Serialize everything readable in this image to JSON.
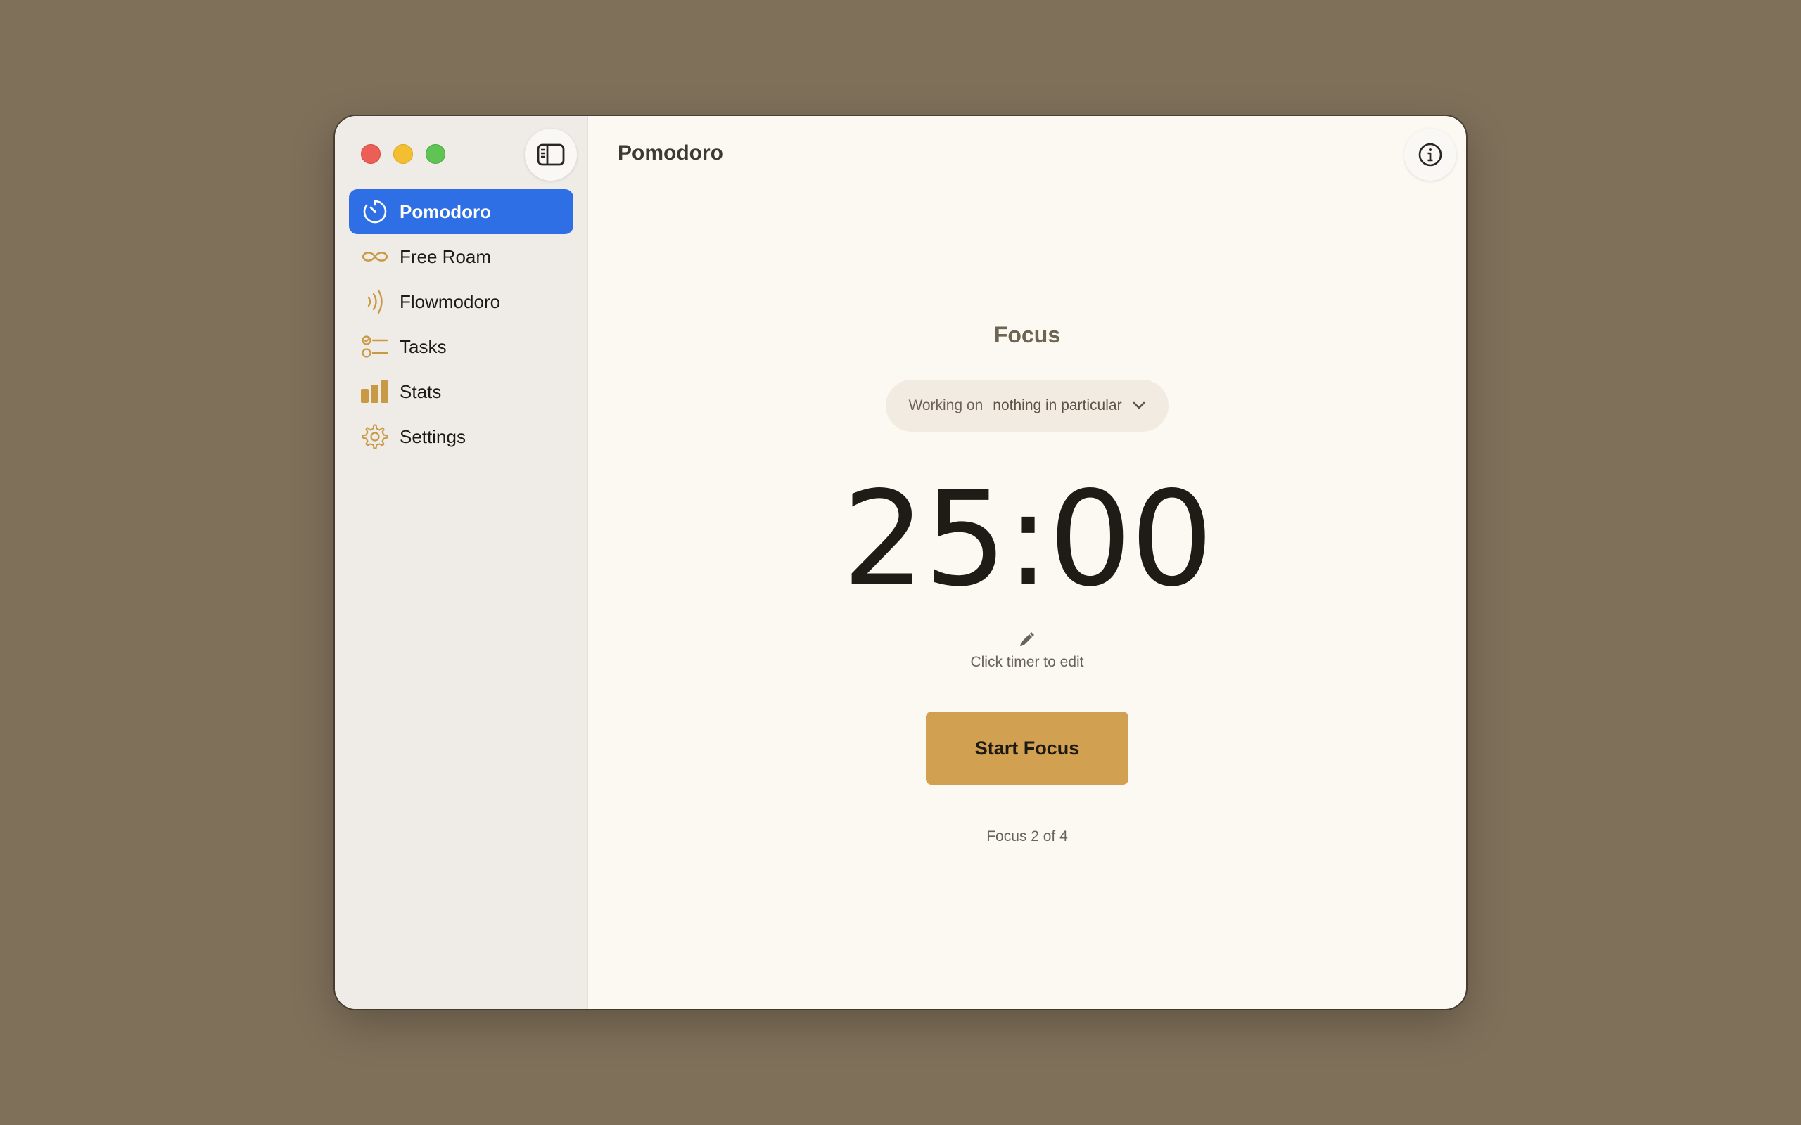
{
  "window": {
    "app_title": "Pomodoro"
  },
  "sidebar": {
    "items": [
      {
        "label": "Pomodoro",
        "icon": "timer-icon",
        "active": true
      },
      {
        "label": "Free Roam",
        "icon": "infinity-icon",
        "active": false
      },
      {
        "label": "Flowmodoro",
        "icon": "waves-icon",
        "active": false
      },
      {
        "label": "Tasks",
        "icon": "checklist-icon",
        "active": false
      },
      {
        "label": "Stats",
        "icon": "bar-chart-icon",
        "active": false
      },
      {
        "label": "Settings",
        "icon": "gear-icon",
        "active": false
      }
    ]
  },
  "main": {
    "mode_label": "Focus",
    "task_picker": {
      "prefix": "Working on",
      "value": "nothing in particular"
    },
    "timer": "25:00",
    "edit_hint": "Click timer to edit",
    "start_button": "Start Focus",
    "session_count": "Focus 2 of 4"
  },
  "colors": {
    "background": "#7f705a",
    "accent": "#d1a050",
    "selection": "#2f6fe6",
    "sidebar": "#efebe6",
    "content": "#fcf9f3"
  }
}
